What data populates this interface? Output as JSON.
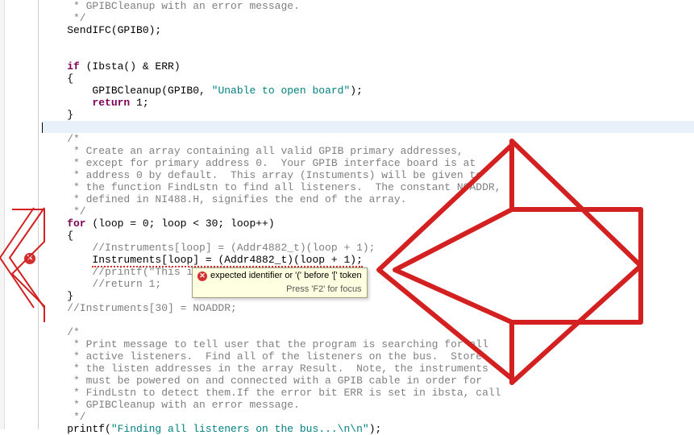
{
  "code": {
    "l1": "     * GPIBCleanup with an error message.",
    "l2": "     */",
    "l3": "    SendIFC(GPIB0);",
    "l4": "",
    "l5": "",
    "l6": "    if (Ibsta() & ERR)",
    "l7": "    {",
    "l8": "        GPIBCleanup(GPIB0, ",
    "l8s": "\"Unable to open board\"",
    "l8e": ");",
    "l9a": "        return",
    "l9b": " 1;",
    "l10": "    }",
    "l11": "",
    "l12": "    /*",
    "l13": "     * Create an array containing all valid GPIB primary addresses,",
    "l14": "     * except for primary address 0.  Your GPIB interface board is at",
    "l15": "     * address 0 by default.  This array (Instuments) will be given to",
    "l16": "     * the function FindLstn to find all listeners.  The constant NOADDR,",
    "l17": "     * defined in NI488.H, signifies the end of the array.",
    "l18": "     */",
    "l19a": "    for",
    "l19b": " (loop = 0; loop < 30; loop++)",
    "l20": "    {",
    "l21": "        //Instruments[loop] = (Addr4882_t)(loop + 1);",
    "l22": "        Instruments[loop] = (Addr4882_t)(loop + 1);",
    "l23": "        //printf(\"This is th",
    "l24": "        //return 1;",
    "l25": "    }",
    "l26": "    //Instruments[30] = NOADDR;",
    "l27": "",
    "l28": "    /*",
    "l29": "     * Print message to tell user that the program is searching for all",
    "l30": "     * active listeners.  Find all of the listeners on the bus.  Store",
    "l31": "     * the listen addresses in the array Result.  Note, the instruments",
    "l32": "     * must be powered on and connected with a GPIB cable in order for",
    "l33": "     * FindLstn to detect them.If the error bit ERR is set in ibsta, call",
    "l34": "     * GPIBCleanup with an error message.",
    "l35": "     */",
    "l36": "    printf(",
    "l36s": "\"Finding all listeners on the bus...\\n\\n\"",
    "l36e": ");"
  },
  "tooltip": {
    "message": "expected identifier or '(' before '[' token",
    "hint": "Press 'F2' for focus"
  },
  "error_icon_glyph": "✕"
}
